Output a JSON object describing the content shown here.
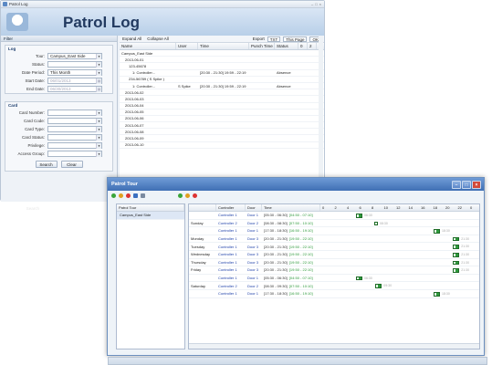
{
  "main_window": {
    "title": "Patrol Log",
    "banner_title": "Patrol Log",
    "filter_label": "Filter",
    "log_group": "Log",
    "card_group": "Card",
    "fields": {
      "tour": {
        "label": "Tour:",
        "value": "Campus_East Side"
      },
      "status": {
        "label": "Status:",
        "value": ""
      },
      "date_period": {
        "label": "Date Period:",
        "value": "This Month"
      },
      "start_date": {
        "label": "Start Date:",
        "value": "06/01/2013"
      },
      "end_date": {
        "label": "End Date:",
        "value": "06/30/2013"
      },
      "card_number": {
        "label": "Card Number:",
        "value": ""
      },
      "card_code": {
        "label": "Card Code:",
        "value": ""
      },
      "card_type": {
        "label": "Card Type:",
        "value": ""
      },
      "card_status": {
        "label": "Card Status:",
        "value": ""
      },
      "privilege": {
        "label": "Privilege:",
        "value": ""
      },
      "access_group": {
        "label": "Access Group:",
        "value": ""
      }
    },
    "search_label": "Search",
    "clear_label": "Clear",
    "toolbar": {
      "expand_all": "Expand All",
      "collapse_all": "Collapse All",
      "export": "Export",
      "export_format": "TXT",
      "page_option": "This Page",
      "ok": "OK"
    },
    "columns": [
      "Name",
      "User",
      "Time",
      "Punch Time",
      "Status"
    ],
    "page_counter": [
      "0",
      "2"
    ],
    "tree": [
      {
        "name": "Campus_East Side",
        "user": "",
        "time": "",
        "punch": "",
        "status": ""
      },
      {
        "name": "2013-06-01",
        "user": "",
        "time": "",
        "punch": "",
        "status": ""
      },
      {
        "name": "123-45678",
        "user": "",
        "time": "",
        "punch": "",
        "status": ""
      },
      {
        "name": "1: Controller...",
        "user": "",
        "time": "[20:30 - 21:30] 19:59 - 22:19",
        "punch": "",
        "status": "Absence"
      },
      {
        "name": "234-56789 ( S Spike )",
        "user": "",
        "time": "",
        "punch": "",
        "status": ""
      },
      {
        "name": "1: Controller...",
        "user": "S Spike",
        "time": "[20:30 - 21:30] 19:59 - 22:19",
        "punch": "",
        "status": "Absence"
      },
      {
        "name": "2013-06-02",
        "user": "",
        "time": "",
        "punch": "",
        "status": ""
      },
      {
        "name": "2013-06-03",
        "user": "",
        "time": "",
        "punch": "",
        "status": ""
      },
      {
        "name": "2013-06-04",
        "user": "",
        "time": "",
        "punch": "",
        "status": ""
      },
      {
        "name": "2013-06-05",
        "user": "",
        "time": "",
        "punch": "",
        "status": ""
      },
      {
        "name": "2013-06-06",
        "user": "",
        "time": "",
        "punch": "",
        "status": ""
      },
      {
        "name": "2013-06-07",
        "user": "",
        "time": "",
        "punch": "",
        "status": ""
      },
      {
        "name": "2013-06-08",
        "user": "",
        "time": "",
        "punch": "",
        "status": ""
      },
      {
        "name": "2013-06-09",
        "user": "",
        "time": "",
        "punch": "",
        "status": ""
      },
      {
        "name": "2013-06-10",
        "user": "",
        "time": "",
        "punch": "",
        "status": ""
      }
    ]
  },
  "tour_window": {
    "title": "Patrol Tour",
    "left_header": "Patrol Tour",
    "tour_item": "Campus_East Side",
    "columns": [
      "Controller",
      "Door",
      "Time"
    ],
    "hours": [
      "0",
      "2",
      "4",
      "6",
      "8",
      "10",
      "12",
      "14",
      "16",
      "18",
      "20",
      "22",
      "0"
    ],
    "rows": [
      {
        "day": "",
        "controller": "Controller 1",
        "door": "Door 1",
        "time": "[05:30 - 06:30]",
        "window": "[04:50 - 07:10]",
        "bar_start": 5.5,
        "bar_end": 6.5
      },
      {
        "day": "Sunday",
        "controller": "Controller 2",
        "door": "Door 2",
        "time": "[08:30 - 08:30]",
        "window": "[07:50 - 10:10]",
        "bar_start": 8.3,
        "bar_end": 8.9
      },
      {
        "day": "",
        "controller": "Controller 1",
        "door": "Door 1",
        "time": "[17:30 - 18:30]",
        "window": "[16:50 - 19:10]",
        "bar_start": 17.5,
        "bar_end": 18.5
      },
      {
        "day": "Monday",
        "controller": "Controller 1",
        "door": "Door 3",
        "time": "[20:30 - 21:30]",
        "window": "[19:50 - 22:10]",
        "bar_start": 20.5,
        "bar_end": 21.5
      },
      {
        "day": "Tuesday",
        "controller": "Controller 1",
        "door": "Door 3",
        "time": "[20:30 - 21:30]",
        "window": "[19:50 - 22:10]",
        "bar_start": 20.5,
        "bar_end": 21.5
      },
      {
        "day": "Wednesday",
        "controller": "Controller 1",
        "door": "Door 3",
        "time": "[20:30 - 21:30]",
        "window": "[19:50 - 22:10]",
        "bar_start": 20.5,
        "bar_end": 21.5
      },
      {
        "day": "Thursday",
        "controller": "Controller 1",
        "door": "Door 3",
        "time": "[20:30 - 21:30]",
        "window": "[19:50 - 22:10]",
        "bar_start": 20.5,
        "bar_end": 21.5
      },
      {
        "day": "Friday",
        "controller": "Controller 1",
        "door": "Door 3",
        "time": "[20:30 - 21:30]",
        "window": "[19:50 - 22:10]",
        "bar_start": 20.5,
        "bar_end": 21.5
      },
      {
        "day": "",
        "controller": "Controller 1",
        "door": "Door 1",
        "time": "[05:30 - 06:30]",
        "window": "[04:50 - 07:10]",
        "bar_start": 5.5,
        "bar_end": 6.5
      },
      {
        "day": "Saturday",
        "controller": "Controller 2",
        "door": "Door 2",
        "time": "[08:30 - 09:30]",
        "window": "[07:50 - 10:10]",
        "bar_start": 8.5,
        "bar_end": 9.5
      },
      {
        "day": "",
        "controller": "Controller 1",
        "door": "Door 1",
        "time": "[17:30 - 18:30]",
        "window": "[16:50 - 19:10]",
        "bar_start": 17.5,
        "bar_end": 18.5
      }
    ]
  },
  "colors": {
    "accent": "#3f6fb4",
    "bar_green": "#2e9a3c",
    "controller_text": "#1c3fa8"
  }
}
